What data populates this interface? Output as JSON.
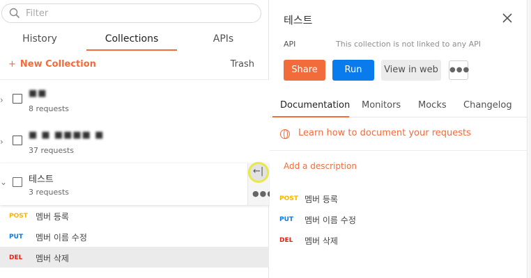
{
  "sidebar": {
    "filter_placeholder": "Filter",
    "tabs": [
      "History",
      "Collections",
      "APIs"
    ],
    "new_collection": "New Collection",
    "trash": "Trash",
    "collections": [
      {
        "name": "■■",
        "requests": "8 requests"
      },
      {
        "name": "■ ■ ■■■■ ■",
        "requests": "37 requests"
      },
      {
        "name": "테스트",
        "requests": "3 requests"
      }
    ],
    "requests": [
      {
        "method": "POST",
        "name": "멤버 등록"
      },
      {
        "method": "PUT",
        "name": "멤버 이름 수정"
      },
      {
        "method": "DEL",
        "name": "멤버 삭제"
      }
    ]
  },
  "panel": {
    "title": "테스트",
    "api_label": "API",
    "api_note": "This collection is not linked to any API",
    "buttons": {
      "share": "Share",
      "run": "Run",
      "view_web": "View in web",
      "more": "●●●"
    },
    "tabs": [
      "Documentation",
      "Monitors",
      "Mocks",
      "Changelog"
    ],
    "learn": "Learn how to document your requests",
    "add_description": "Add a description",
    "requests": [
      {
        "method": "POST",
        "name": "멤버 등록"
      },
      {
        "method": "PUT",
        "name": "멤버 이름 수정"
      },
      {
        "method": "DEL",
        "name": "멤버 삭제"
      }
    ]
  },
  "colors": {
    "accent": "#f26b3a",
    "run": "#097bed",
    "post": "#ffb400",
    "put": "#097bed",
    "del": "#eb2013"
  },
  "icons": {
    "search": "search-icon",
    "close": "close-icon",
    "globe": "globe-icon",
    "collapse": "collapse-sidebar-icon"
  }
}
